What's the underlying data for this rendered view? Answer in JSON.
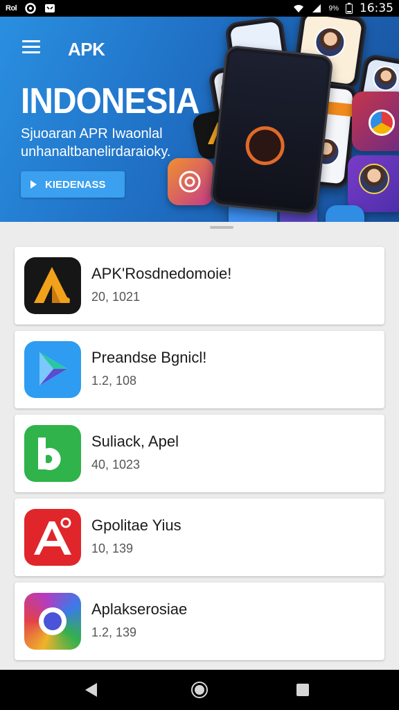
{
  "status_bar": {
    "carrier": "Rol",
    "battery": "9%",
    "time": "16:35"
  },
  "banner": {
    "brand": "APK",
    "headline": "INDONESIA",
    "subtitle": "Sjuoaran APR Iwaonlal unhanaltbanelirdaraioky.",
    "cta_label": "KIEDENASS",
    "colors": {
      "gradient_start": "#2a8fe0",
      "gradient_end": "#19509a",
      "cta": "#3aa0ef"
    }
  },
  "apps": [
    {
      "name": "APK'Rosdnedomoie!",
      "count": "20, 1021",
      "icon": "apk-a-icon"
    },
    {
      "name": "Preandse Bgnicl!",
      "count": "1.2, 108",
      "icon": "play-store-icon"
    },
    {
      "name": "Suliack, Apel",
      "count": "40, 1023",
      "icon": "b-app-icon"
    },
    {
      "name": "Gpolitae Yius",
      "count": "10, 139",
      "icon": "red-a-icon"
    },
    {
      "name": "Aplakserosiae",
      "count": "1.2, 139",
      "icon": "chrome-like-icon"
    }
  ]
}
